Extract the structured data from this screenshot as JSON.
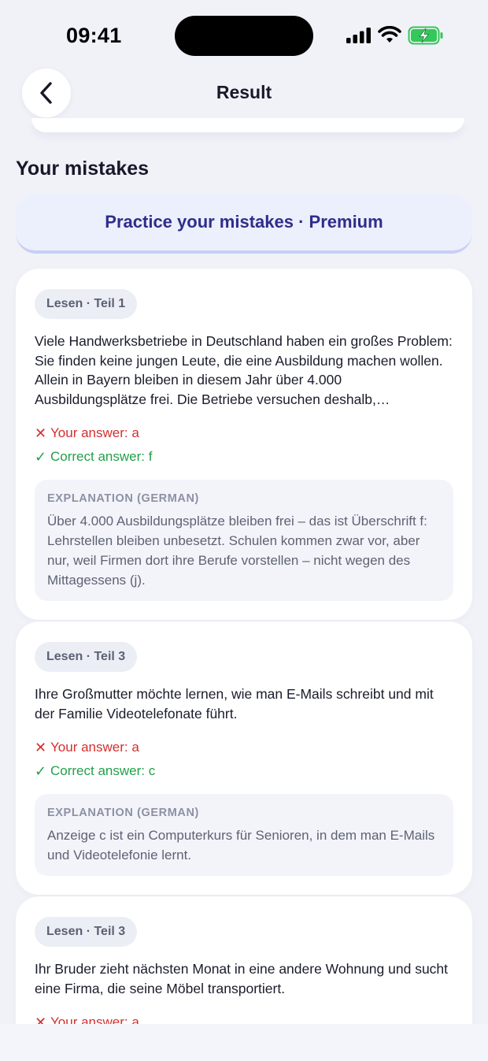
{
  "status_bar": {
    "time": "09:41"
  },
  "header": {
    "title": "Result",
    "back_icon": "chevron-left-icon"
  },
  "section_title": "Your mistakes",
  "practice_button": "Practice your mistakes · Premium",
  "colors": {
    "wrong": "#d32f2f",
    "correct": "#23a04a",
    "accent": "#2f2d8a"
  },
  "mistakes": [
    {
      "tag": "Lesen · Teil 1",
      "question": "Viele Handwerksbetriebe in Deutschland haben ein großes Problem: Sie finden keine jungen Leute, die eine Ausbildung machen wollen. Allein in Bayern bleiben in diesem Jahr über 4.000 Ausbildungsplätze frei. Die Betriebe versuchen deshalb,…",
      "your_answer": "Your answer: a",
      "correct_answer": "Correct answer: f",
      "explanation_label": "EXPLANATION (GERMAN)",
      "explanation": "Über 4.000 Ausbildungsplätze bleiben frei – das ist Überschrift f: Lehrstellen bleiben unbesetzt. Schulen kommen zwar vor, aber nur, weil Firmen dort ihre Berufe vorstellen – nicht wegen des Mittagessens (j)."
    },
    {
      "tag": "Lesen · Teil 3",
      "question": "Ihre Großmutter möchte lernen, wie man E-Mails schreibt und mit der Familie Videotelefonate führt.",
      "your_answer": "Your answer: a",
      "correct_answer": "Correct answer: c",
      "explanation_label": "EXPLANATION (GERMAN)",
      "explanation": "Anzeige c ist ein Computerkurs für Senioren, in dem man E-Mails und Videotelefonie lernt."
    },
    {
      "tag": "Lesen · Teil 3",
      "question": "Ihr Bruder zieht nächsten Monat in eine andere Wohnung und sucht eine Firma, die seine Möbel transportiert.",
      "your_answer": "Your answer: a"
    }
  ]
}
